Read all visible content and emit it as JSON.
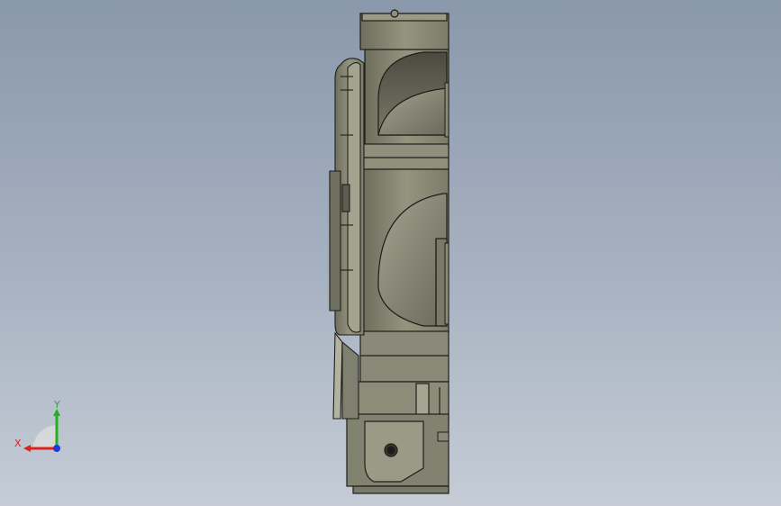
{
  "viewport": {
    "background_top": "#8a98ac",
    "background_bottom": "#c5ccd6"
  },
  "model": {
    "body_color": "#8a8a76",
    "edge_color": "#1e1e1a",
    "highlight_color": "#c9c9b8"
  },
  "triad": {
    "x_label": "X",
    "y_label": "Y",
    "x_color": "#e0201a",
    "y_color": "#1fb21f",
    "z_color": "#1f3ad6"
  }
}
